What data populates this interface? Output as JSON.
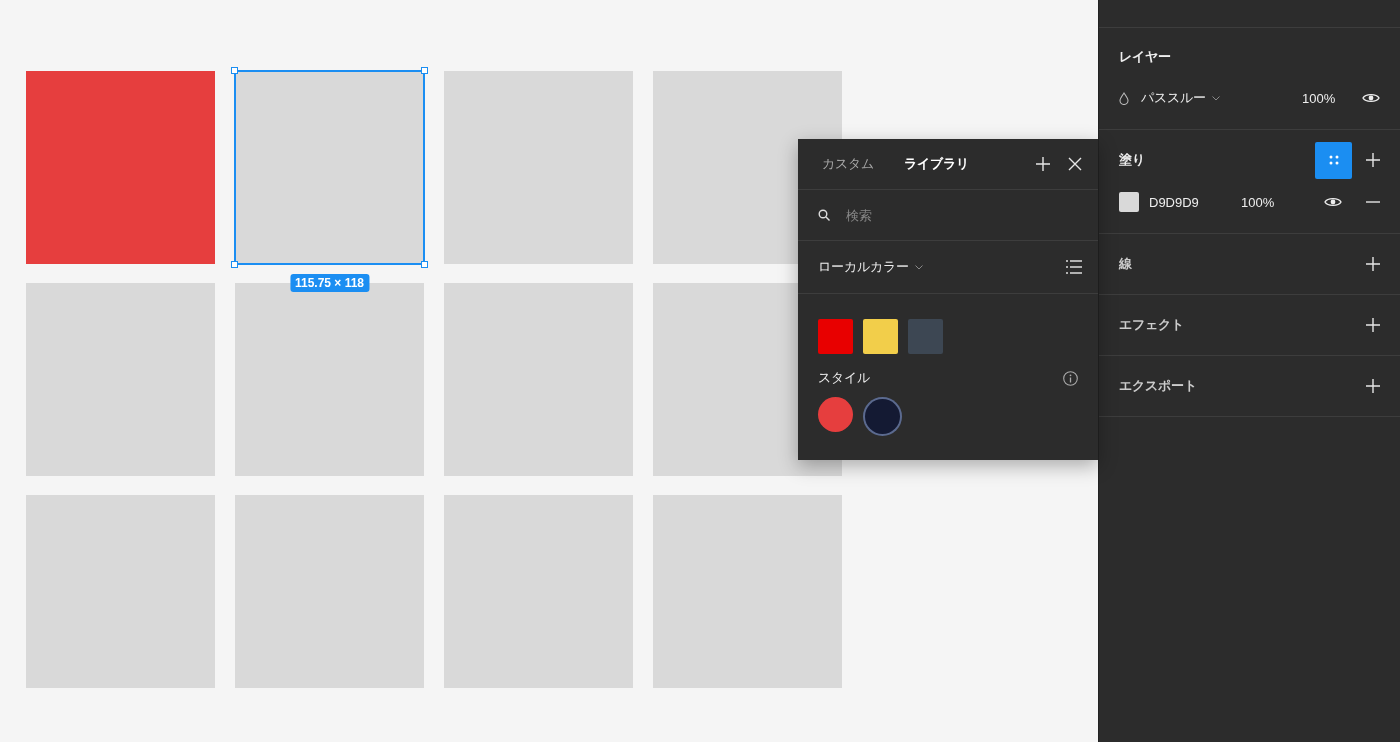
{
  "canvas": {
    "frames": [
      {
        "color": "#e63e3e",
        "selected": false
      },
      {
        "color": "#d9d9d9",
        "selected": true
      },
      {
        "color": "#d9d9d9",
        "selected": false
      },
      {
        "color": "#d9d9d9",
        "selected": false
      },
      {
        "color": "#d9d9d9",
        "selected": false
      },
      {
        "color": "#d9d9d9",
        "selected": false
      },
      {
        "color": "#d9d9d9",
        "selected": false
      },
      {
        "color": "#d9d9d9",
        "selected": false
      },
      {
        "color": "#d9d9d9",
        "selected": false
      },
      {
        "color": "#d9d9d9",
        "selected": false
      },
      {
        "color": "#d9d9d9",
        "selected": false
      },
      {
        "color": "#d9d9d9",
        "selected": false
      }
    ],
    "selection_size": "115.75 × 118"
  },
  "color_picker": {
    "tabs": [
      {
        "label": "カスタム",
        "selected": false
      },
      {
        "label": "ライブラリ",
        "selected": true
      }
    ],
    "search": {
      "placeholder": "検索"
    },
    "library": "ローカルカラー",
    "swatches": [
      {
        "color": "#e80000"
      },
      {
        "color": "#f2ce4a"
      },
      {
        "color": "#3d4753"
      }
    ],
    "styles_title": "スタイル",
    "style_swatches": [
      {
        "color": "#e63e3e",
        "selected": false
      },
      {
        "color": "#141a33",
        "selected": true
      }
    ]
  },
  "properties": {
    "layer": {
      "title": "レイヤー",
      "blend_mode": "パススルー",
      "opacity": "100%",
      "visible": true
    },
    "fill": {
      "title": "塗り",
      "items": [
        {
          "hex": "D9D9D9",
          "opacity": "100%",
          "visible": true
        }
      ]
    },
    "sections": [
      {
        "title": "線"
      },
      {
        "title": "エフェクト"
      },
      {
        "title": "エクスポート"
      }
    ]
  }
}
